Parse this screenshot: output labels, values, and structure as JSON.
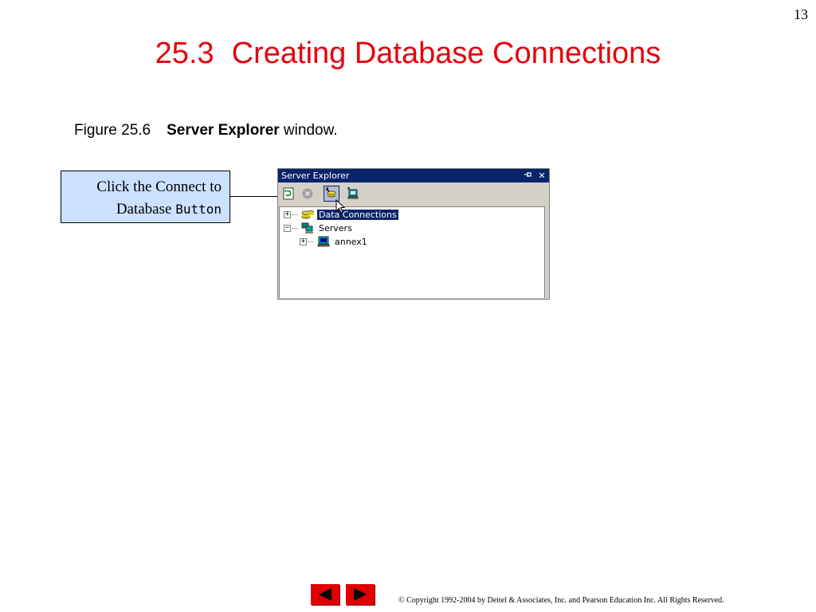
{
  "page": {
    "number": "13"
  },
  "title": {
    "section": "25.3",
    "text": "Creating Database Connections"
  },
  "caption": {
    "figure": "Figure 25.6",
    "bold": "Server Explorer",
    "rest": " window."
  },
  "callout": {
    "line1": "Click the Connect to",
    "line2a": "Database ",
    "line2b": "Button"
  },
  "window": {
    "title": "Server Explorer",
    "pin_glyph": "-ₐ",
    "close_glyph": "✕",
    "toolbar": [
      "refresh-icon",
      "stop-icon",
      "connect-to-database-icon",
      "connect-to-server-icon"
    ],
    "tree": [
      {
        "label": "Data Connections",
        "expander": "+",
        "icon": "database-icon",
        "selected": true
      },
      {
        "label": "Servers",
        "expander": "−",
        "icon": "servers-icon",
        "selected": false
      },
      {
        "label": "annex1",
        "expander": "+",
        "icon": "computer-icon",
        "selected": false
      }
    ]
  },
  "nav": {
    "prev": "previous-slide-icon",
    "next": "next-slide-icon"
  },
  "footer": {
    "copyright": "© Copyright 1992-2004 by Deitel & Associates, Inc. and Pearson Education Inc. All Rights Reserved."
  },
  "colors": {
    "title": "#e8000b",
    "callout_bg": "#cce0ff",
    "titlebar": "#0a246a",
    "nav_button": "#e00000"
  }
}
